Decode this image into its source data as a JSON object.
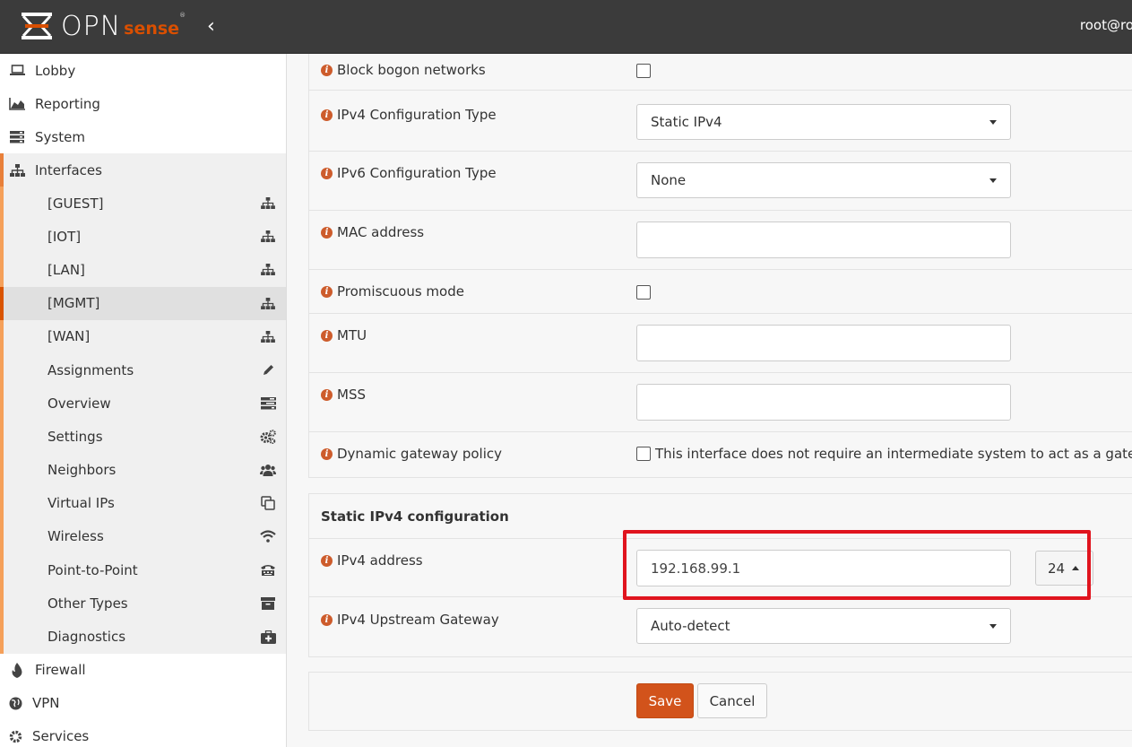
{
  "header": {
    "logo_main": "OPN",
    "logo_sense": "sense",
    "logo_reg": "®",
    "collapse_glyph": "‹",
    "user": "root@ro"
  },
  "sidebar": {
    "items_top": [
      {
        "label": "Lobby",
        "icon": "laptop-icon"
      },
      {
        "label": "Reporting",
        "icon": "area-chart-icon"
      },
      {
        "label": "System",
        "icon": "server-icon"
      },
      {
        "label": "Interfaces",
        "icon": "sitemap-icon"
      }
    ],
    "interfaces_sub": [
      {
        "label": "[GUEST]",
        "icon": "sitemap-icon"
      },
      {
        "label": "[IOT]",
        "icon": "sitemap-icon"
      },
      {
        "label": "[LAN]",
        "icon": "sitemap-icon"
      },
      {
        "label": "[MGMT]",
        "icon": "sitemap-icon"
      },
      {
        "label": "[WAN]",
        "icon": "sitemap-icon"
      },
      {
        "label": "Assignments",
        "icon": "pencil-icon"
      },
      {
        "label": "Overview",
        "icon": "tasks-icon"
      },
      {
        "label": "Settings",
        "icon": "cogs-icon"
      },
      {
        "label": "Neighbors",
        "icon": "users-icon"
      },
      {
        "label": "Virtual IPs",
        "icon": "clone-icon"
      },
      {
        "label": "Wireless",
        "icon": "wifi-icon"
      },
      {
        "label": "Point-to-Point",
        "icon": "tty-icon"
      },
      {
        "label": "Other Types",
        "icon": "archive-icon"
      },
      {
        "label": "Diagnostics",
        "icon": "medkit-icon"
      }
    ],
    "items_bottom": [
      {
        "label": "Firewall",
        "icon": "fire-icon"
      },
      {
        "label": "VPN",
        "icon": "globe-icon"
      },
      {
        "label": "Services",
        "icon": "cog-icon"
      }
    ],
    "active_sub": "[MGMT]"
  },
  "general": {
    "block_bogon": {
      "label": "Block bogon networks",
      "checked": false
    },
    "ipv4_type": {
      "label": "IPv4 Configuration Type",
      "value": "Static IPv4"
    },
    "ipv6_type": {
      "label": "IPv6 Configuration Type",
      "value": "None"
    },
    "mac": {
      "label": "MAC address",
      "value": ""
    },
    "promisc": {
      "label": "Promiscuous mode",
      "checked": false
    },
    "mtu": {
      "label": "MTU",
      "value": ""
    },
    "mss": {
      "label": "MSS",
      "value": ""
    },
    "dyn_gw": {
      "label": "Dynamic gateway policy",
      "checkbox_text": "This interface does not require an intermediate system to act as a gateway",
      "checked": false
    }
  },
  "static_ipv4": {
    "section_title": "Static IPv4 configuration",
    "address": {
      "label": "IPv4 address",
      "value": "192.168.99.1",
      "cidr": "24"
    },
    "gateway": {
      "label": "IPv4 Upstream Gateway",
      "value": "Auto-detect"
    }
  },
  "actions": {
    "save": "Save",
    "cancel": "Cancel"
  },
  "colors": {
    "accent": "#d2531b",
    "highlight": "#e0141e",
    "topbar": "#3b3b3b"
  },
  "info_glyph": "i"
}
